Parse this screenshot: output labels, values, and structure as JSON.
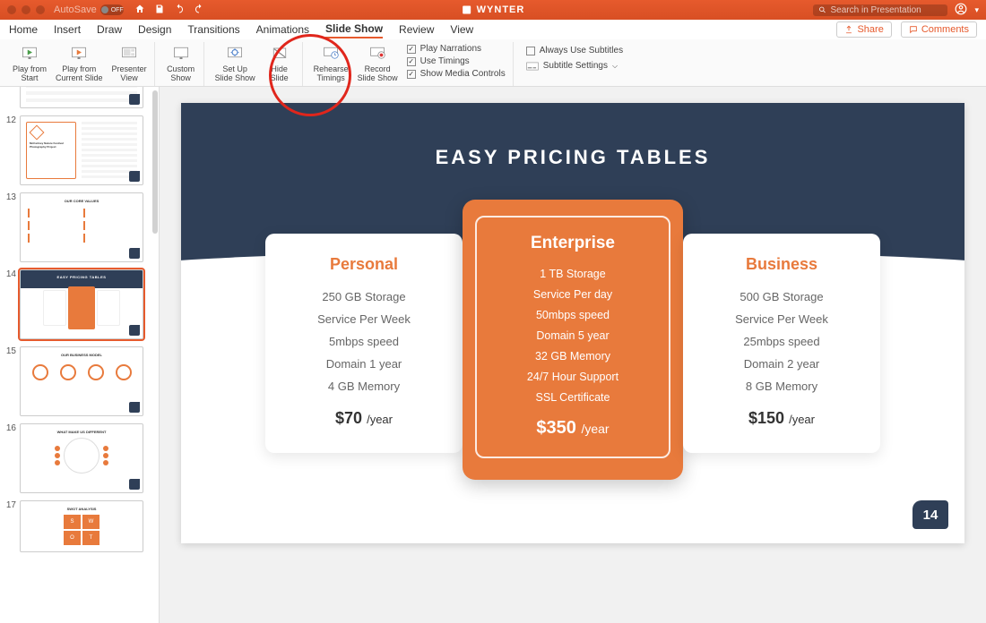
{
  "titlebar": {
    "autosave_label": "AutoSave",
    "autosave_state": "OFF",
    "doc_title": "WYNTER",
    "search_placeholder": "Search in Presentation"
  },
  "menu": {
    "tabs": [
      "Home",
      "Insert",
      "Draw",
      "Design",
      "Transitions",
      "Animations",
      "Slide Show",
      "Review",
      "View"
    ],
    "active_tab": "Slide Show",
    "share": "Share",
    "comments": "Comments"
  },
  "ribbon": {
    "play_from_start": "Play from\nStart",
    "play_from_current": "Play from\nCurrent Slide",
    "presenter_view": "Presenter\nView",
    "custom_show": "Custom\nShow",
    "setup_show": "Set Up\nSlide Show",
    "hide_slide": "Hide\nSlide",
    "rehearse": "Rehearse\nTimings",
    "record": "Record\nSlide Show",
    "play_narrations": "Play Narrations",
    "use_timings": "Use Timings",
    "show_media": "Show Media Controls",
    "always_subtitles": "Always Use Subtitles",
    "subtitle_settings": "Subtitle Settings"
  },
  "thumbs": {
    "numbers": [
      "12",
      "13",
      "14",
      "15",
      "16",
      "17"
    ],
    "selected": "14",
    "t13_title": "OUR CORE VALUES",
    "t14_title": "EASY PRICING TABLES",
    "t15_title": "OUR BUSINESS MODEL",
    "t16_title": "WHAT MAKE US DIFFERENT",
    "t17_title": "SWOT ANALYSIS"
  },
  "slide": {
    "title": "EASY PRICING TABLES",
    "page_number": "14",
    "plans": {
      "personal": {
        "name": "Personal",
        "f1": "250 GB Storage",
        "f2": "Service Per Week",
        "f3": "5mbps speed",
        "f4": "Domain 1 year",
        "f5": "4 GB Memory",
        "price": "$70",
        "period": "/year"
      },
      "enterprise": {
        "name": "Enterprise",
        "f1": "1 TB Storage",
        "f2": "Service Per day",
        "f3": "50mbps speed",
        "f4": "Domain 5 year",
        "f5": "32 GB Memory",
        "f6": "24/7 Hour Support",
        "f7": "SSL Certificate",
        "price": "$350",
        "period": "/year"
      },
      "business": {
        "name": "Business",
        "f1": "500 GB Storage",
        "f2": "Service Per Week",
        "f3": "25mbps speed",
        "f4": "Domain 2 year",
        "f5": "8 GB Memory",
        "price": "$150",
        "period": "/year"
      }
    }
  }
}
